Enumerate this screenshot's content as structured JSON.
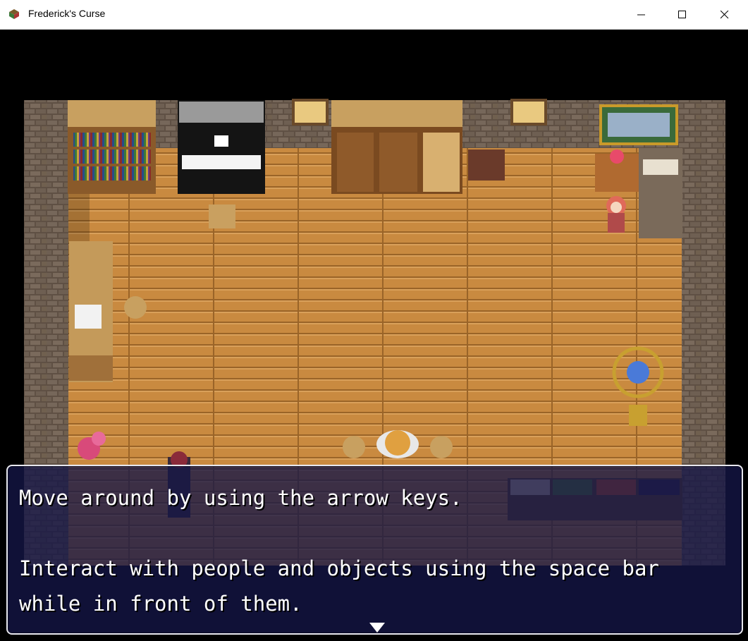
{
  "window": {
    "title": "Frederick's Curse",
    "minimize_label": "",
    "maximize_label": "",
    "close_label": ""
  },
  "dialog": {
    "line1": "Move around by using the arrow keys.",
    "line2": "Interact with people and objects using the space bar",
    "line3": "while in front of them."
  },
  "icons": {
    "app": "game-app-icon",
    "minimize": "minimize-icon",
    "maximize": "maximize-icon",
    "close": "close-icon",
    "continue": "continue-arrow-icon"
  },
  "colors": {
    "floor": "#c8843c",
    "stone": "#6b5a4c",
    "dialog_bg": "#141646",
    "dialog_border": "#e8e8f0"
  }
}
